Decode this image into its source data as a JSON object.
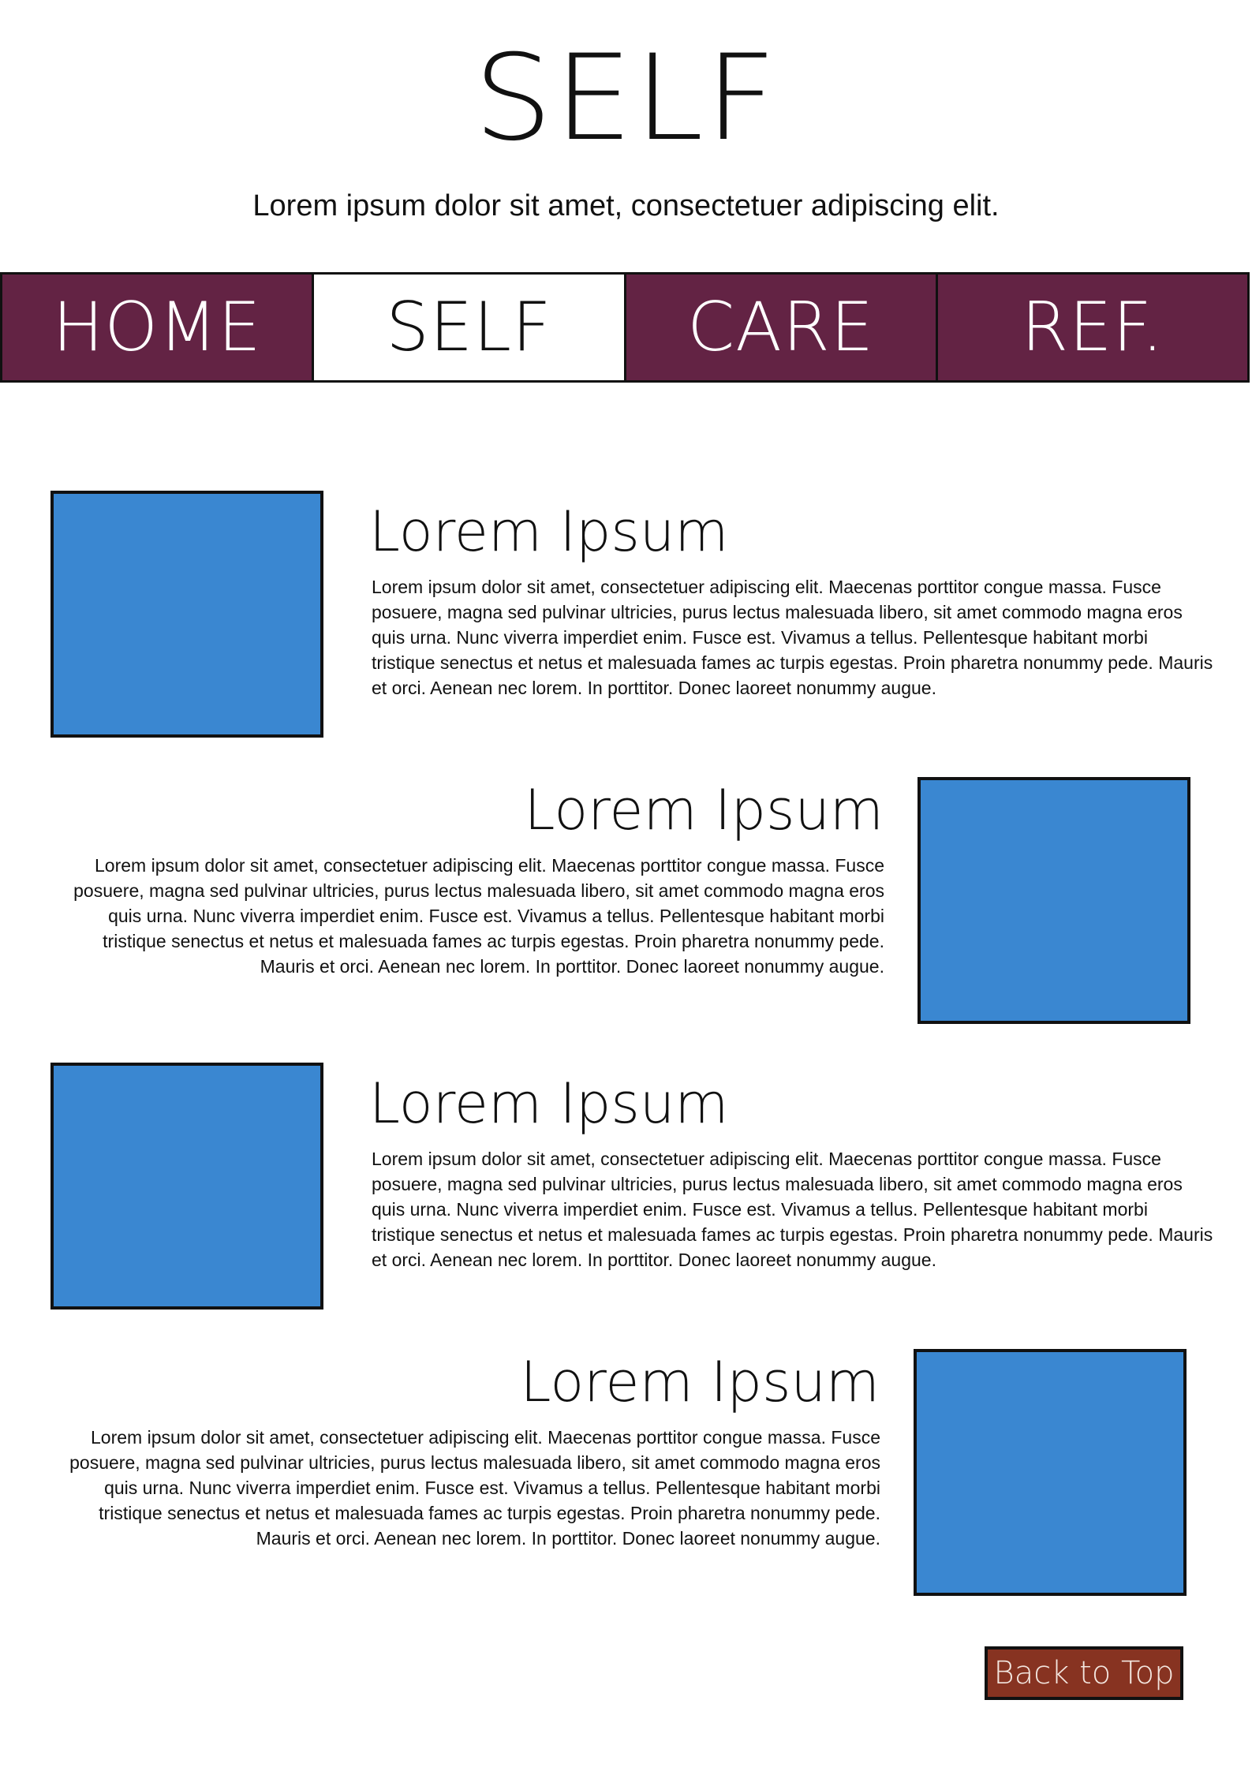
{
  "header": {
    "title": "SELF",
    "subtitle": "Lorem ipsum dolor sit amet, consectetuer adipiscing elit."
  },
  "nav": {
    "items": [
      {
        "label": "HOME",
        "active": false
      },
      {
        "label": "SELF",
        "active": true
      },
      {
        "label": "CARE",
        "active": false
      },
      {
        "label": "REF.",
        "active": false
      }
    ]
  },
  "sections": [
    {
      "heading": "Lorem Ipsum",
      "body": "Lorem ipsum dolor sit amet, consectetuer adipiscing elit. Maecenas porttitor congue massa. Fusce posuere, magna sed pulvinar ultricies, purus lectus malesuada libero, sit amet commodo magna eros quis urna. Nunc viverra imperdiet enim. Fusce est. Vivamus a tellus. Pellentesque habitant morbi tristique senectus et netus et malesuada fames ac turpis egestas. Proin pharetra nonummy pede. Mauris et orci. Aenean nec lorem. In porttitor. Donec laoreet nonummy augue."
    },
    {
      "heading": "Lorem Ipsum",
      "body": "Lorem ipsum dolor sit amet, consectetuer adipiscing elit. Maecenas porttitor congue massa. Fusce posuere, magna sed pulvinar ultricies, purus lectus malesuada libero, sit amet commodo magna eros quis urna. Nunc viverra imperdiet enim. Fusce est. Vivamus a tellus. Pellentesque habitant morbi tristique senectus et netus et malesuada fames ac turpis egestas. Proin pharetra nonummy pede. Mauris et orci. Aenean nec lorem. In porttitor. Donec laoreet nonummy augue."
    },
    {
      "heading": "Lorem Ipsum",
      "body": "Lorem ipsum dolor sit amet, consectetuer adipiscing elit. Maecenas porttitor congue massa. Fusce posuere, magna sed pulvinar ultricies, purus lectus malesuada libero, sit amet commodo magna eros quis urna. Nunc viverra imperdiet enim. Fusce est. Vivamus a tellus. Pellentesque habitant morbi tristique senectus et netus et malesuada fames ac turpis egestas. Proin pharetra nonummy pede. Mauris et orci. Aenean nec lorem. In porttitor. Donec laoreet nonummy augue."
    },
    {
      "heading": "Lorem Ipsum",
      "body": "Lorem ipsum dolor sit amet, consectetuer adipiscing elit. Maecenas porttitor congue massa. Fusce posuere, magna sed pulvinar ultricies, purus lectus malesuada libero, sit amet commodo magna eros quis urna. Nunc viverra imperdiet enim. Fusce est. Vivamus a tellus. Pellentesque habitant morbi tristique senectus et netus et malesuada fames ac turpis egestas. Proin pharetra nonummy pede. Mauris et orci. Aenean nec lorem. In porttitor. Donec laoreet nonummy augue."
    }
  ],
  "footer": {
    "back_to_top_label": "Back to Top"
  },
  "colors": {
    "nav_background": "#632344",
    "image_placeholder": "#3a87d1",
    "back_to_top_background": "#873321"
  }
}
